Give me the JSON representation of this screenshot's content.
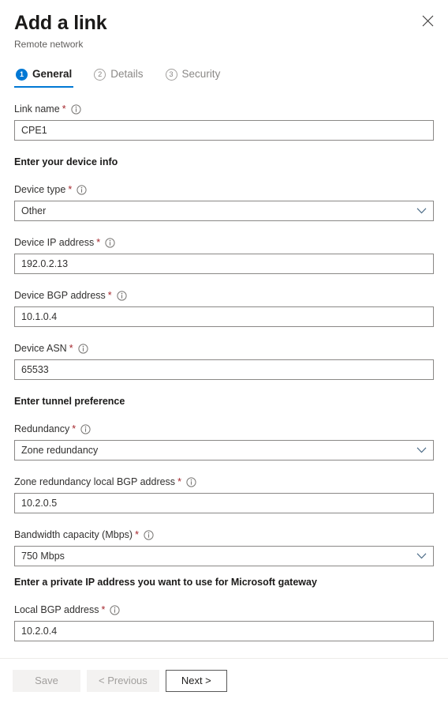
{
  "header": {
    "title": "Add a link",
    "subtitle": "Remote network",
    "close_icon": "close-icon"
  },
  "tabs": [
    {
      "number": "1",
      "label": "General",
      "active": true
    },
    {
      "number": "2",
      "label": "Details",
      "active": false
    },
    {
      "number": "3",
      "label": "Security",
      "active": false
    }
  ],
  "form": {
    "link_name": {
      "label": "Link name",
      "required": "*",
      "info_icon": "info-icon",
      "value": "CPE1"
    },
    "device_section_heading": "Enter your device info",
    "device_type": {
      "label": "Device type",
      "required": "*",
      "info_icon": "info-icon",
      "value": "Other",
      "chevron_icon": "chevron-down-icon"
    },
    "device_ip": {
      "label": "Device IP address",
      "required": "*",
      "info_icon": "info-icon",
      "value": "192.0.2.13"
    },
    "device_bgp": {
      "label": "Device BGP address",
      "required": "*",
      "info_icon": "info-icon",
      "value": "10.1.0.4"
    },
    "device_asn": {
      "label": "Device ASN",
      "required": "*",
      "info_icon": "info-icon",
      "value": "65533"
    },
    "tunnel_section_heading": "Enter tunnel preference",
    "redundancy": {
      "label": "Redundancy",
      "required": "*",
      "info_icon": "info-icon",
      "value": "Zone redundancy",
      "chevron_icon": "chevron-down-icon"
    },
    "zone_redundancy_bgp": {
      "label": "Zone redundancy local BGP address",
      "required": "*",
      "info_icon": "info-icon",
      "value": "10.2.0.5"
    },
    "bandwidth": {
      "label": "Bandwidth capacity (Mbps)",
      "required": "*",
      "info_icon": "info-icon",
      "value": "750 Mbps",
      "chevron_icon": "chevron-down-icon"
    },
    "gateway_section_heading": "Enter a private IP address you want to use for Microsoft gateway",
    "local_bgp": {
      "label": "Local BGP address",
      "required": "*",
      "info_icon": "info-icon",
      "value": "10.2.0.4"
    }
  },
  "footer": {
    "save_label": "Save",
    "previous_label": "< Previous",
    "next_label": "Next >"
  },
  "colors": {
    "accent": "#0078d4",
    "required_red": "#a4262c",
    "text_primary": "#323130",
    "text_muted": "#605e5c",
    "border": "#8a8886"
  }
}
